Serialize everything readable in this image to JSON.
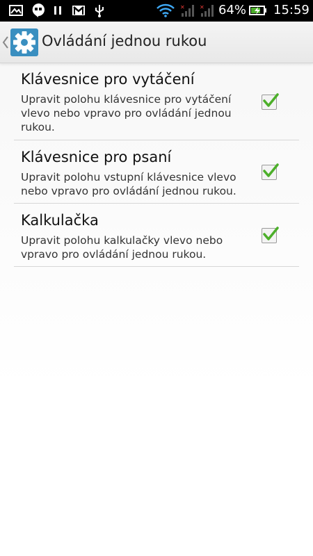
{
  "status_bar": {
    "battery_percent": "64%",
    "time": "15:59",
    "icons": [
      "gallery-icon",
      "hangouts-icon",
      "pause-icon",
      "gmail-icon",
      "usb-icon",
      "wifi-icon",
      "signal-sim1-icon",
      "signal-sim2-icon",
      "battery-icon"
    ]
  },
  "action_bar": {
    "title": "Ovládání jednou rukou",
    "icon": "settings-gear-icon",
    "accent": "#3a8fc0"
  },
  "settings": [
    {
      "title": "Klávesnice pro vytáčení",
      "summary": "Upravit polohu klávesnice pro vytáčení vlevo nebo vpravo pro ovládání jednou rukou.",
      "checked": true
    },
    {
      "title": "Klávesnice pro psaní",
      "summary": "Upravit polohu vstupní klávesnice vlevo nebo vpravo pro ovládání jednou rukou.",
      "checked": true
    },
    {
      "title": "Kalkulačka",
      "summary": "Upravit polohu kalkulačky vlevo nebo vpravo pro ovládání jednou rukou.",
      "checked": true
    }
  ],
  "check_color": "#4caf2a"
}
